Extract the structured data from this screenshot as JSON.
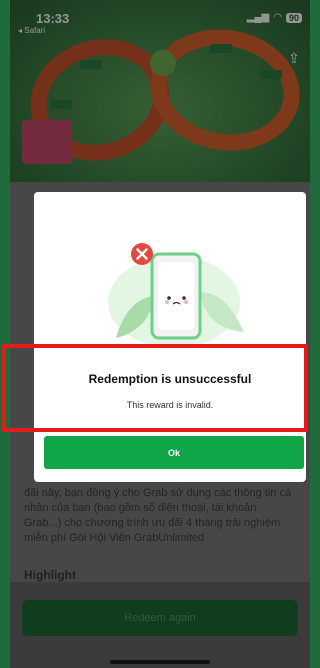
{
  "status_bar": {
    "time": "13:33",
    "back_app": "◂ Safari",
    "battery": "90"
  },
  "page": {
    "body_text": "đãi này, bạn đồng ý cho Grab sử dụng các thông tin cá nhân của bạn (bao gồm số điện thoại, tài khoản Grab...) cho chương trình ưu đãi 4 tháng trải nghiệm miễn phí Gói Hội Viên GrabUnlimited",
    "section_heading": "Highlight",
    "redeem_again_label": "Redeem again"
  },
  "modal": {
    "title": "Redemption is unsuccessful",
    "message": "This reward is invalid.",
    "ok_label": "Ok"
  },
  "colors": {
    "brand_green": "#0ea646",
    "error_red": "#e5483e",
    "highlight_red": "#e31b1b"
  },
  "icons": {
    "error": "x-circle-icon",
    "share": "share-icon"
  }
}
